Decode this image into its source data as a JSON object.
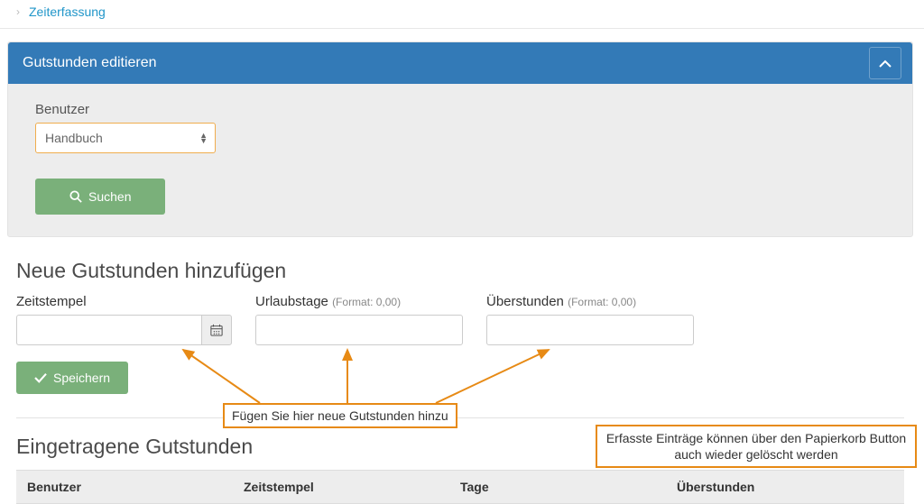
{
  "breadcrumb": {
    "item": "Zeiterfassung"
  },
  "panel": {
    "title": "Gutstunden editieren",
    "user_label": "Benutzer",
    "user_value": "Handbuch",
    "search_label": "Suchen"
  },
  "add": {
    "title": "Neue Gutstunden hinzufügen",
    "timestamp_label": "Zeitstempel",
    "vacation_label": "Urlaubstage",
    "vacation_hint": "(Format: 0,00)",
    "overtime_label": "Überstunden",
    "overtime_hint": "(Format: 0,00)",
    "save_label": "Speichern"
  },
  "list": {
    "title": "Eingetragene Gutstunden",
    "col_user": "Benutzer",
    "col_timestamp": "Zeitstempel",
    "col_days": "Tage",
    "col_overtime": "Überstunden"
  },
  "annotations": {
    "add_hint": "Fügen Sie hier neue Gutstunden hinzu",
    "delete_hint": "Erfasste Einträge können über den Papierkorb Button auch wieder gelöscht werden"
  }
}
